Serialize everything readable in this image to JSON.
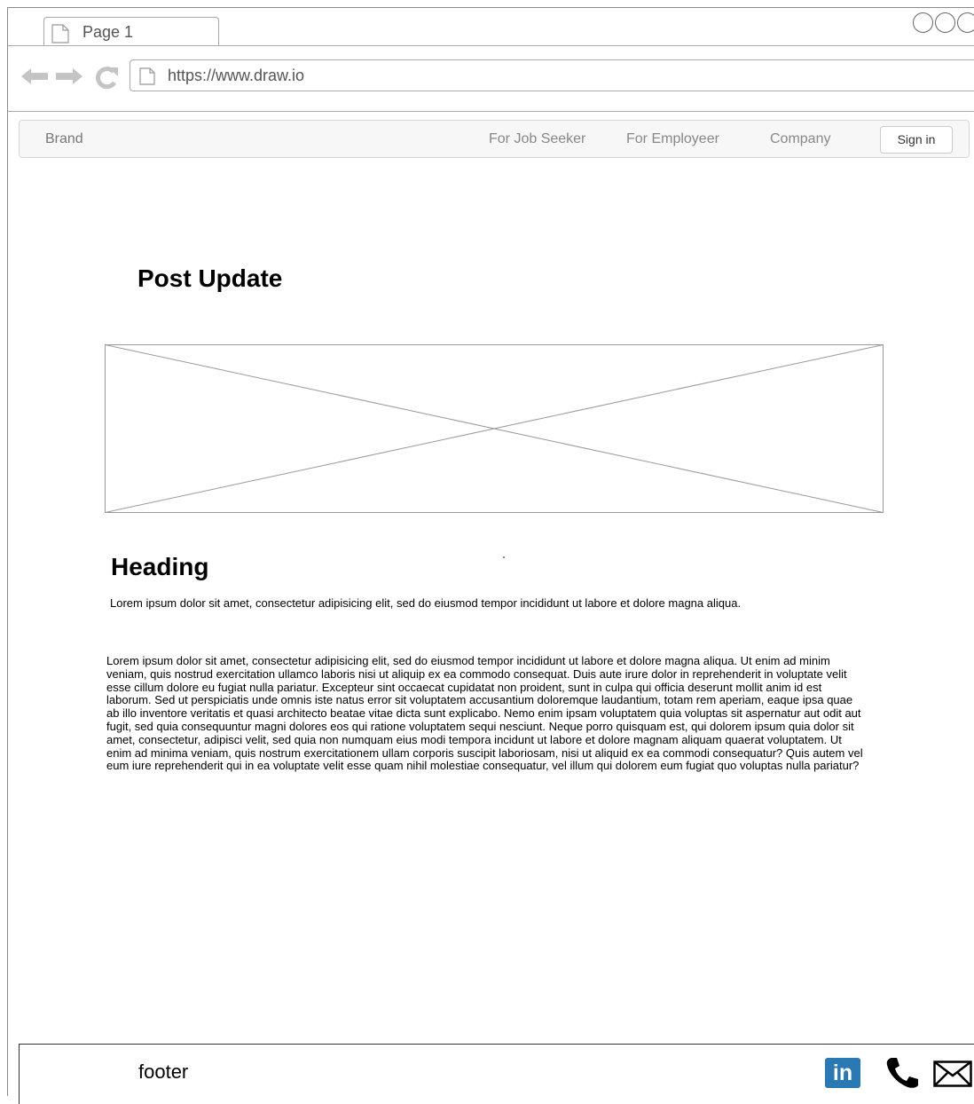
{
  "browser": {
    "tab_label": "Page 1",
    "url": "https://www.draw.io"
  },
  "navbar": {
    "brand": "Brand",
    "links": [
      "For Job Seeker",
      "For Employeer",
      "Company"
    ],
    "signin_label": "Sign in"
  },
  "main": {
    "title": "Post Update",
    "heading": "Heading",
    "lead": "Lorem ipsum dolor sit amet, consectetur adipisicing elit, sed do eiusmod tempor incididunt ut labore et dolore magna aliqua.",
    "body": "Lorem ipsum dolor sit amet, consectetur adipisicing elit, sed do eiusmod tempor incididunt ut labore et dolore magna aliqua. Ut enim ad minim veniam, quis nostrud exercitation ullamco laboris nisi ut aliquip ex ea commodo consequat. Duis aute irure dolor in reprehenderit in voluptate velit esse cillum dolore eu fugiat nulla pariatur. Excepteur sint occaecat cupidatat non proident, sunt in culpa qui officia deserunt mollit anim id est laborum. Sed ut perspiciatis unde omnis iste natus error sit voluptatem accusantium doloremque laudantium, totam rem aperiam, eaque ipsa quae ab illo inventore veritatis et quasi architecto beatae vitae dicta sunt explicabo. Nemo enim ipsam voluptatem quia voluptas sit aspernatur aut odit aut fugit, sed quia consequuntur magni dolores eos qui ratione voluptatem sequi nesciunt. Neque porro quisquam est, qui dolorem ipsum quia dolor sit amet, consectetur, adipisci velit, sed quia non numquam eius modi tempora incidunt ut labore et dolore magnam aliquam quaerat voluptatem. Ut enim ad minima veniam, quis nostrum exercitationem ullam corporis suscipit laboriosam, nisi ut aliquid ex ea commodi consequatur? Quis autem vel eum iure reprehenderit qui in ea voluptate velit esse quam nihil molestiae consequatur, vel illum qui dolorem eum fugiat quo voluptas nulla pariatur?"
  },
  "footer": {
    "label": "footer",
    "linkedin_text": "in",
    "icons": [
      "linkedin-icon",
      "phone-icon",
      "mail-icon"
    ],
    "linkedin_color": "#2a78b4"
  }
}
